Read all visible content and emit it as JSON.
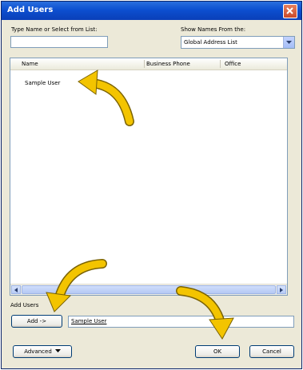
{
  "window": {
    "title": "Add Users"
  },
  "search": {
    "label": "Type Name or Select from List:",
    "value": ""
  },
  "address_book": {
    "label": "Show Names From the:",
    "selected": "Global Address List"
  },
  "table": {
    "columns": [
      "Name",
      "Business Phone",
      "Office"
    ],
    "rows": [
      {
        "name": "Sample User",
        "business_phone": "",
        "office": ""
      }
    ]
  },
  "add_users": {
    "label": "Add Users",
    "add_button": "Add ->",
    "value": "Sample User"
  },
  "footer": {
    "advanced_button": "Advanced",
    "ok_button": "OK",
    "cancel_button": "Cancel"
  },
  "icons": {
    "close": "close-icon",
    "dropdown": "chevron-down-icon",
    "scroll_left": "scroll-left-icon",
    "scroll_right": "scroll-right-icon",
    "annotation": "curved-arrow-icon"
  },
  "colors": {
    "titlebar": "#0c4fd0",
    "dialog": "#ece9d8",
    "annotation_arrow": "#f3c400"
  }
}
